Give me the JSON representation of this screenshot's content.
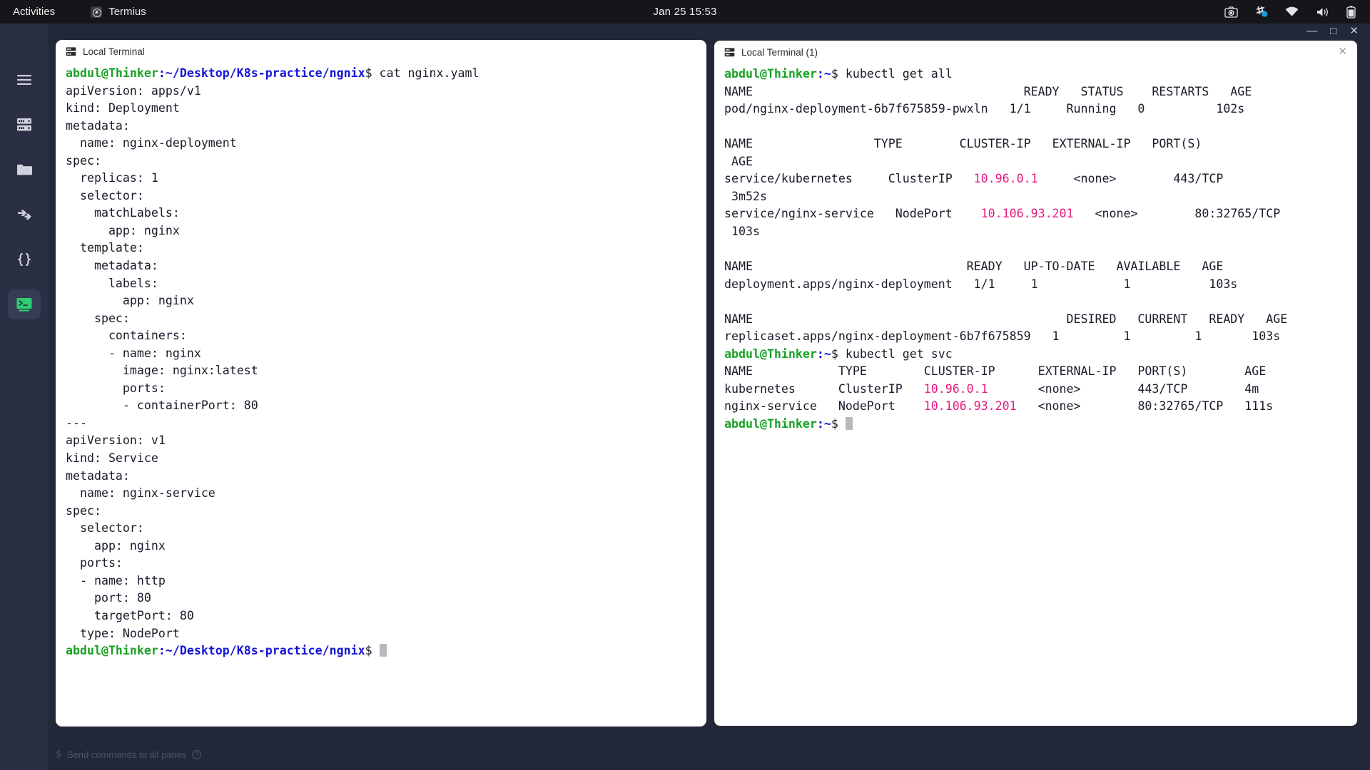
{
  "topbar": {
    "activities": "Activities",
    "app_name": "Termius",
    "clock": "Jan 25  15:53",
    "tray_icons": [
      "screenshot-icon",
      "network-settings-icon",
      "wifi-icon",
      "volume-icon",
      "battery-icon"
    ]
  },
  "window_controls": {
    "minimize": "—",
    "maximize": "□",
    "close": "✕"
  },
  "sidebar": {
    "items": [
      {
        "name": "hamburger-menu",
        "label": "Menu",
        "active": false
      },
      {
        "name": "hosts",
        "label": "Hosts",
        "active": false
      },
      {
        "name": "sftp",
        "label": "SFTP",
        "active": false
      },
      {
        "name": "port-forwarding",
        "label": "Port Forwarding",
        "active": false
      },
      {
        "name": "snippets",
        "label": "Snippets",
        "active": false
      },
      {
        "name": "terminal",
        "label": "Terminal",
        "active": true
      }
    ]
  },
  "panes": {
    "left": {
      "tab_title": "Local Terminal",
      "prompt_user": "abdul@Thinker",
      "prompt_path": ":~/Desktop/K8s-practice/ngnix",
      "command": "$ cat nginx.yaml",
      "output": [
        "apiVersion: apps/v1",
        "kind: Deployment",
        "metadata:",
        "  name: nginx-deployment",
        "spec:",
        "  replicas: 1",
        "  selector:",
        "    matchLabels:",
        "      app: nginx",
        "  template:",
        "    metadata:",
        "      labels:",
        "        app: nginx",
        "    spec:",
        "      containers:",
        "      - name: nginx",
        "        image: nginx:latest",
        "        ports:",
        "        - containerPort: 80",
        "---",
        "apiVersion: v1",
        "kind: Service",
        "metadata:",
        "  name: nginx-service",
        "spec:",
        "  selector:",
        "    app: nginx",
        "  ports:",
        "  - name: http",
        "    port: 80",
        "    targetPort: 80",
        "  type: NodePort"
      ],
      "final_prompt_command": "$ "
    },
    "right": {
      "tab_title": "Local Terminal (1)",
      "close_label": "✕",
      "prompt_user": "abdul@Thinker",
      "prompt_path": ":~",
      "command_1": "$ kubectl get all",
      "pods_header": "NAME                                      READY   STATUS    RESTARTS   AGE",
      "pods_row": "pod/nginx-deployment-6b7f675859-pwxln   1/1     Running   0          102s",
      "svc_header_line1": "NAME                 TYPE        CLUSTER-IP",
      "svc_header_cols": "   EXTERNAL-IP   PORT(S)",
      "svc_header_line2": " AGE",
      "svc_row1_name": "service/kubernetes     ClusterIP   ",
      "svc_row1_ip": "10.96.0.1",
      "svc_row1_rest": "     <none>        443/TCP",
      "svc_row1_age": " 3m52s",
      "svc_row2_name": "service/nginx-service   NodePort    ",
      "svc_row2_ip": "10.106.93.201",
      "svc_row2_rest": "   <none>        80:32765/TCP",
      "svc_row2_age": " 103s",
      "deploy_header": "NAME                              READY   UP-TO-DATE   AVAILABLE   AGE",
      "deploy_row": "deployment.apps/nginx-deployment   1/1     1            1           103s",
      "rs_header": "NAME                                            DESIRED   CURRENT   READY   AGE",
      "rs_row": "replicaset.apps/nginx-deployment-6b7f675859   1         1         1       103s",
      "command_2": "$ kubectl get svc",
      "svc2_header": "NAME            TYPE        CLUSTER-IP      EXTERNAL-IP   PORT(S)        AGE",
      "svc2_row1_name": "kubernetes      ClusterIP   ",
      "svc2_row1_ip": "10.96.0.1",
      "svc2_row1_rest": "       <none>        443/TCP        4m",
      "svc2_row2_name": "nginx-service   NodePort    ",
      "svc2_row2_ip": "10.106.93.201",
      "svc2_row2_rest": "   <none>        80:32765/TCP   111s",
      "final_prompt_command": "$ "
    }
  },
  "statusbar": {
    "dollar": "$",
    "text": "Send commands to all panes",
    "help": "?"
  },
  "colors": {
    "window_bg": "#232839",
    "rail_bg": "#2a2f43",
    "rail_active": "#363c52",
    "terminal_bg": "#ffffff",
    "prompt_green": "#18a125",
    "path_blue": "#1414d6",
    "ip_magenta": "#e5197f",
    "terminal_fg": "#1b1b2a",
    "accent_green": "#2fcc71"
  }
}
